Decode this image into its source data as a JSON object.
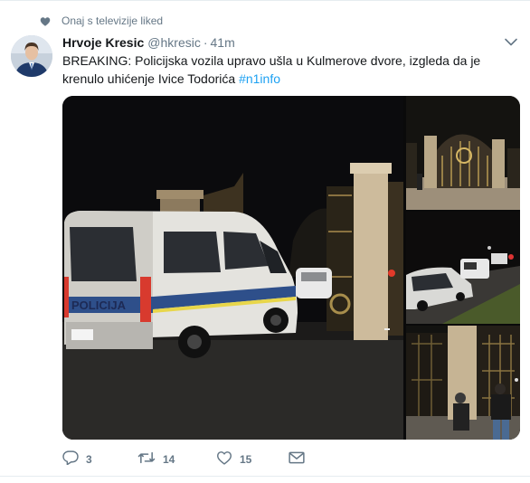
{
  "context": {
    "text": "Onaj s televizije liked",
    "icon": "heart-icon"
  },
  "tweet": {
    "author_name": "Hrvoje Kresic",
    "author_handle": "@hkresic",
    "separator": "·",
    "timestamp": "41m",
    "text": "BREAKING: Policijska vozila upravo ušla u Kulmerove dvore, izgleda da je krenulo uhićenje Ivice Todorića ",
    "hashtag": "#n1info",
    "van_label": "POLICIJA"
  },
  "actions": {
    "reply": {
      "icon": "reply-icon",
      "count": "3"
    },
    "retweet": {
      "icon": "retweet-icon",
      "count": "14"
    },
    "like": {
      "icon": "heart-outline-icon",
      "count": "15"
    },
    "dm": {
      "icon": "envelope-icon"
    }
  },
  "colors": {
    "text": "#14171a",
    "secondary": "#657786",
    "link": "#1da1f2",
    "border": "#e6ecf0"
  }
}
